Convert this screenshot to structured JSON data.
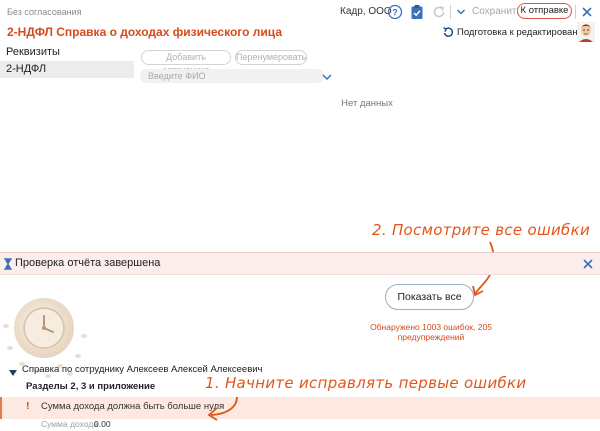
{
  "header": {
    "approval_status": "Без согласования",
    "organization": "Кадр, ООО",
    "save_label": "Сохранить",
    "send_label": "К отправке",
    "icons": [
      "help-icon",
      "clipboard-check-icon",
      "refresh-icon",
      "chevron-down-icon",
      "close-icon"
    ]
  },
  "document": {
    "title": "2-НДФЛ Справка о доходах физического лица",
    "prepare_edit_label": "Подготовка к редактированию"
  },
  "sidebar": {
    "items": [
      {
        "label": "Реквизиты"
      },
      {
        "label": "2-НДФЛ"
      }
    ]
  },
  "toolbar": {
    "add_employee_label": "Добавить сотрудника",
    "renumber_label": "Перенумеровать",
    "search_placeholder": "Введите ФИО"
  },
  "main": {
    "empty_text": "Нет данных"
  },
  "annotations": {
    "step2": "2. Посмотрите все ошибки",
    "step1": "1. Начните исправлять первые ошибки"
  },
  "check_panel": {
    "title": "Проверка отчёта завершена",
    "show_all_label": "Показать все",
    "summary": "Обнаружено 1003 ошибок, 205 предупреждений",
    "employee": "Справка по сотруднику Алексеев Алексей Алексеевич",
    "sections": "Разделы 2, 3 и приложение",
    "error_mark": "!",
    "error_text": "Сумма дохода должна быть больше нуля",
    "detail_label": "Сумма дохода",
    "detail_value": "0.00"
  },
  "colors": {
    "accent": "#d64a1b",
    "panel_header_bg": "#fbeeec",
    "error_row_bg": "#fde9e1",
    "button_border": "#9ab0c6"
  }
}
